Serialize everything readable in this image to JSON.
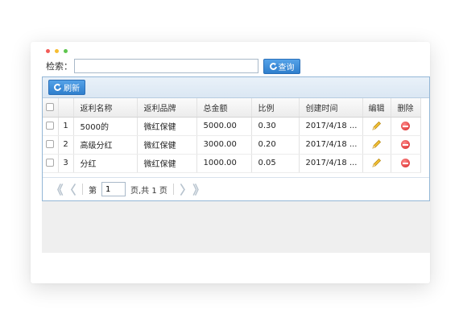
{
  "search": {
    "label": "检索：",
    "value": "",
    "button_label": "查询"
  },
  "toolbar": {
    "refresh_label": "刷新"
  },
  "grid": {
    "columns": [
      "返利名称",
      "返利品牌",
      "总金额",
      "比例",
      "创建时间",
      "编辑",
      "删除"
    ],
    "rows": [
      {
        "num": "1",
        "name": "5000的",
        "brand": "微红保健",
        "amount": "5000.00",
        "ratio": "0.30",
        "created": "2017/4/18 ..."
      },
      {
        "num": "2",
        "name": "高级分红",
        "brand": "微红保健",
        "amount": "3000.00",
        "ratio": "0.20",
        "created": "2017/4/18 ..."
      },
      {
        "num": "3",
        "name": "分红",
        "brand": "微红保健",
        "amount": "1000.00",
        "ratio": "0.05",
        "created": "2017/4/18 ..."
      }
    ]
  },
  "pager": {
    "before": "第",
    "page_value": "1",
    "after": "页,共 1 页",
    "first": "《",
    "prev": "〈",
    "next": "〉",
    "last": "》"
  },
  "colors": {
    "accent": "#3b8ad8",
    "panel_border": "#94b7d6",
    "toolbar_bg": "#dbe7f3"
  },
  "icons": {
    "edit": "pencil-icon",
    "delete": "delete-icon",
    "refresh": "refresh-icon"
  }
}
